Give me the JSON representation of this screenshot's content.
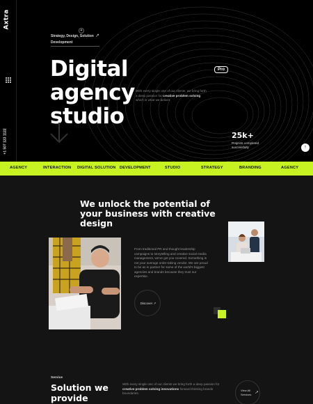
{
  "brand": {
    "logo_text": "Axtra"
  },
  "rail": {
    "phone": "+1 507 123 1122"
  },
  "hero": {
    "tagline": "Strategy, Design, Solution Development",
    "title_line1": "Digital agency",
    "title_line2": "studio",
    "badge": "Pro",
    "desc_prefix": "With every single one of our clients, we bring forth a deep passion for ",
    "desc_bold": "creative problem solving",
    "desc_suffix": " which is what we deliver.",
    "stat_value": "25k+",
    "stat_label": "Projects completed successfully",
    "scroll_top": "↑"
  },
  "marquee": {
    "items": [
      "AGENCY",
      "INTERACTION",
      "DIGITAL SOLUTION",
      "DEVELOPMENT",
      "STUDIO",
      "STRATEGY",
      "BRANDING",
      "AGENCY"
    ]
  },
  "about": {
    "title": "We unlock the potential of your business with creative design",
    "text": "From traditional PR and thought leadership campaigns to storytelling and creative social media management, we've got you covered. Something is not your average order-taking vendor. We are proud to be an in partner for some of the world's biggest agencies and brands because they trust our expertise.",
    "discover_label": "Discover ↗"
  },
  "services": {
    "tag": "Service",
    "title": "Solution we provide",
    "text_prefix": "With every single one of our clients we bring forth a deep passion for ",
    "text_bold": "creative problem solving innovations",
    "text_suffix": " forward thinking brands boundaries.",
    "view_all": "View All Services",
    "view_all_arrow": "↗"
  },
  "colors": {
    "accent": "#c6f321",
    "bg_dark": "#000000",
    "bg_section": "#141414"
  }
}
